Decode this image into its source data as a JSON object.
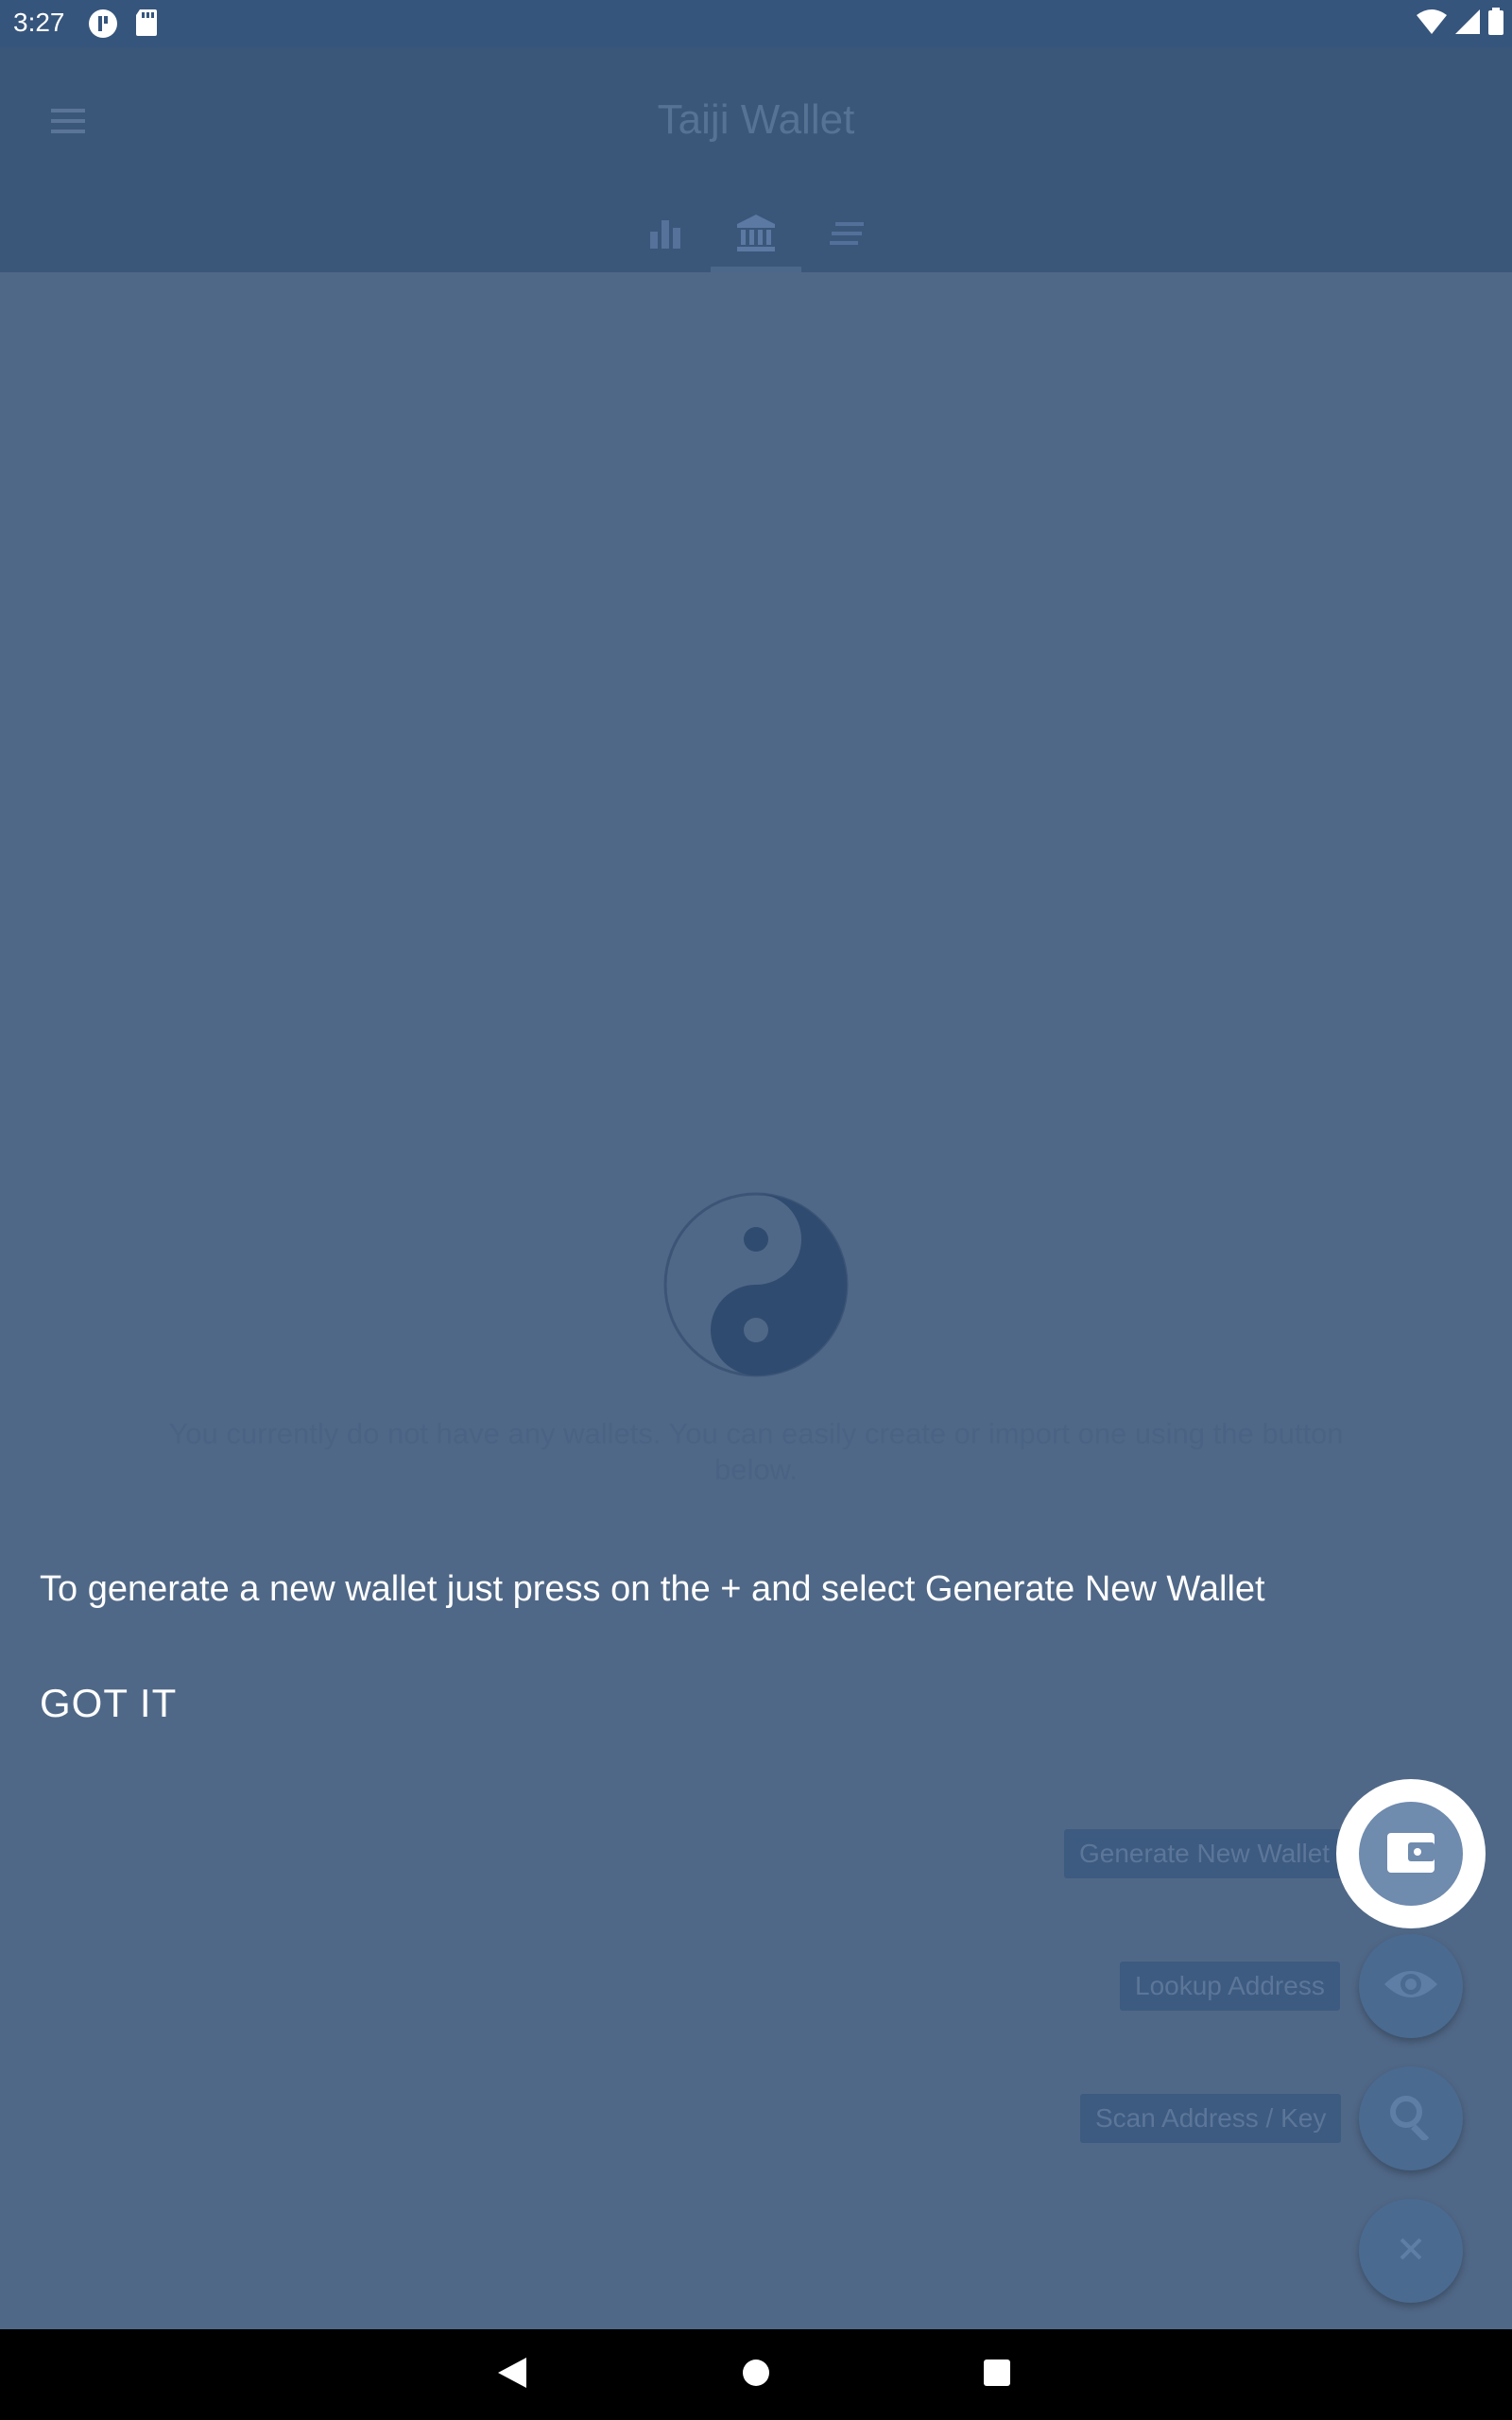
{
  "status_bar": {
    "time": "3:27"
  },
  "app_bar": {
    "title": "Taiji Wallet",
    "tabs": [
      {
        "icon": "bar-chart-icon"
      },
      {
        "icon": "bank-icon",
        "selected": true
      },
      {
        "icon": "list-icon"
      }
    ]
  },
  "empty_state": {
    "icon": "yin-yang-icon",
    "message": "You currently do not have any wallets. You can easily create or import one using the button below."
  },
  "tutorial": {
    "message": "To generate a new wallet just press on the + and select Generate New Wallet",
    "dismiss_label": "GOT IT"
  },
  "fab_menu": {
    "items": [
      {
        "label": "Generate New Wallet",
        "icon": "wallet-icon"
      },
      {
        "label": "Lookup Address",
        "icon": "eye-icon"
      },
      {
        "label": "Scan Address / Key",
        "icon": "search-icon"
      }
    ],
    "close_icon": "close-icon"
  },
  "colors": {
    "status_bar": "#36557c",
    "app_bar": "#3a5679",
    "overlay_background": "#506887",
    "fab": "#4a6a90"
  }
}
